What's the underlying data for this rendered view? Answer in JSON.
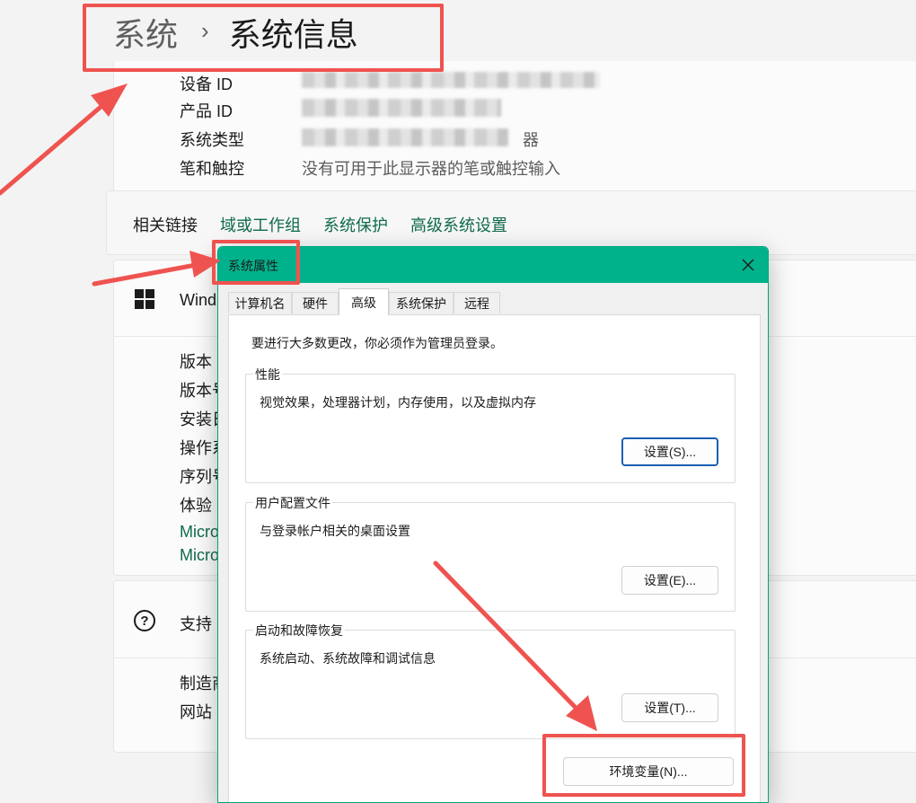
{
  "breadcrumb": {
    "parent": "系统",
    "separator": "›",
    "current": "系统信息"
  },
  "device_specs": {
    "rows": [
      {
        "label": "设备 ID",
        "value": ""
      },
      {
        "label": "产品 ID",
        "value": ""
      },
      {
        "label": "系统类型",
        "value": "器"
      },
      {
        "label": "笔和触控",
        "value": "没有可用于此显示器的笔或触控输入"
      }
    ]
  },
  "related_links": {
    "title": "相关链接",
    "items": [
      "域或工作组",
      "系统保护",
      "高级系统设置"
    ]
  },
  "windows_spec": {
    "heading": "Wind",
    "rows": [
      "版本",
      "版本号",
      "安装日",
      "操作系",
      "序列号",
      "体验"
    ],
    "links": [
      "Micro",
      "Micro"
    ]
  },
  "support": {
    "title": "支持",
    "rows": [
      "制造商",
      "网站"
    ]
  },
  "dialog": {
    "title": "系统属性",
    "tabs": [
      "计算机名",
      "硬件",
      "高级",
      "系统保护",
      "远程"
    ],
    "active_tab": "高级",
    "admin_note": "要进行大多数更改，你必须作为管理员登录。",
    "groups": [
      {
        "title": "性能",
        "desc": "视觉效果，处理器计划，内存使用，以及虚拟内存",
        "button": "设置(S)..."
      },
      {
        "title": "用户配置文件",
        "desc": "与登录帐户相关的桌面设置",
        "button": "设置(E)..."
      },
      {
        "title": "启动和故障恢复",
        "desc": "系统启动、系统故障和调试信息",
        "button": "设置(T)..."
      }
    ],
    "env_button": "环境变量(N)..."
  },
  "colors": {
    "accent_titlebar": "#00b28b",
    "link_green": "#0f6b4a",
    "annotation_red": "#ef5350"
  }
}
